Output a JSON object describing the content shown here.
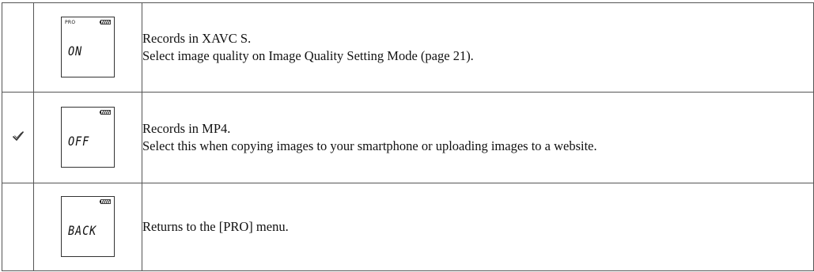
{
  "rows": [
    {
      "checked": false,
      "lcd": {
        "indicator": "PRO",
        "readout": "ON"
      },
      "lines": [
        "Records in XAVC S.",
        "Select image quality on Image Quality Setting Mode (page 21)."
      ]
    },
    {
      "checked": true,
      "lcd": {
        "indicator": "",
        "readout": "OFF"
      },
      "lines": [
        "Records in MP4.",
        "Select this when copying images to your smartphone or uploading images to a website."
      ]
    },
    {
      "checked": false,
      "lcd": {
        "indicator": "",
        "readout": "BACK"
      },
      "lines": [
        "Returns to the [PRO] menu."
      ]
    }
  ],
  "icons": {
    "check": "checkmark-icon",
    "battery": "battery-icon"
  },
  "colors": {
    "border": "#555555",
    "text": "#111111"
  }
}
